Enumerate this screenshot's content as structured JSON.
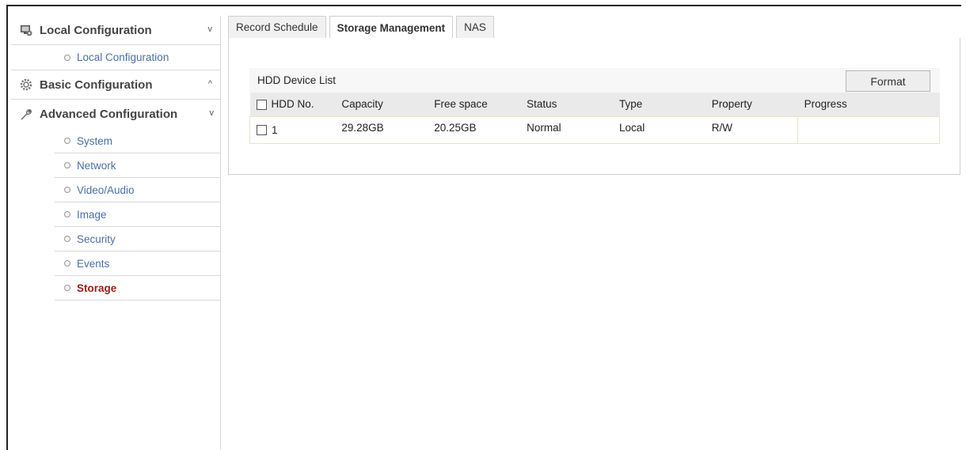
{
  "sidebar": {
    "local": {
      "label": "Local Configuration",
      "icon": "monitor-gear-icon",
      "chevron": "v",
      "items": [
        {
          "label": "Local Configuration"
        }
      ]
    },
    "basic": {
      "label": "Basic Configuration",
      "icon": "gear-icon",
      "chevron": "^"
    },
    "advanced": {
      "label": "Advanced Configuration",
      "icon": "wrench-icon",
      "chevron": "v",
      "items": [
        {
          "label": "System"
        },
        {
          "label": "Network"
        },
        {
          "label": "Video/Audio"
        },
        {
          "label": "Image"
        },
        {
          "label": "Security"
        },
        {
          "label": "Events"
        },
        {
          "label": "Storage",
          "active": true
        }
      ]
    }
  },
  "tabs": [
    {
      "label": "Record Schedule"
    },
    {
      "label": "Storage Management",
      "active": true
    },
    {
      "label": "NAS"
    }
  ],
  "hdd_list": {
    "title": "HDD Device List",
    "format_label": "Format",
    "columns": [
      "HDD No.",
      "Capacity",
      "Free space",
      "Status",
      "Type",
      "Property",
      "Progress"
    ],
    "rows": [
      {
        "no": "1",
        "capacity": "29.28GB",
        "free": "20.25GB",
        "status": "Normal",
        "type": "Local",
        "property": "R/W",
        "progress": ""
      }
    ]
  },
  "colors": {
    "active_item": "#9b1c12",
    "link": "#4a6fa5",
    "row_border": "#e9e3c6"
  }
}
